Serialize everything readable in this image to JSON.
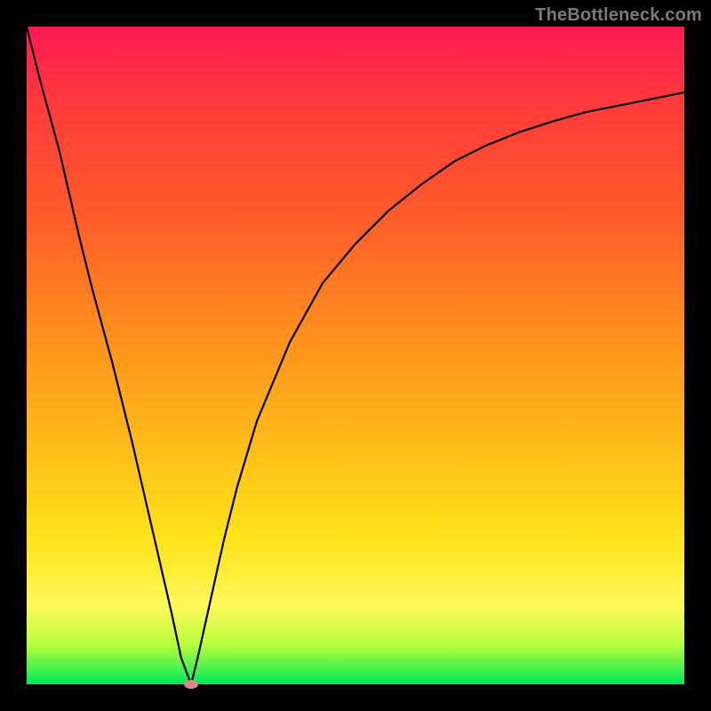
{
  "watermark": "TheBottleneck.com",
  "colors": {
    "frame_background": "#000000",
    "gradient_top": "#ff1a53",
    "gradient_bottom": "#00e85a",
    "curve_stroke": "#000000",
    "marker_fill": "#d98a8a"
  },
  "chart_data": {
    "type": "line",
    "title": "",
    "xlabel": "",
    "ylabel": "",
    "xlim": [
      0,
      100
    ],
    "ylim": [
      0,
      100
    ],
    "grid": false,
    "legend": false,
    "annotations": [
      {
        "text": "TheBottleneck.com",
        "position": "top-right"
      }
    ],
    "series": [
      {
        "name": "bottleneck-curve",
        "x": [
          0,
          2,
          5,
          8,
          10,
          13,
          16,
          19,
          22,
          23.5,
          25,
          26,
          28,
          30,
          32,
          35,
          40,
          45,
          50,
          55,
          60,
          65,
          70,
          75,
          80,
          85,
          90,
          95,
          100
        ],
        "y": [
          100,
          92,
          81,
          68,
          60,
          49,
          37,
          24,
          11,
          4,
          0,
          4,
          13,
          22,
          30,
          40,
          52,
          61,
          67,
          72,
          76,
          79.5,
          82,
          84,
          85.6,
          87,
          88,
          89,
          90
        ]
      }
    ],
    "markers": [
      {
        "name": "min-point",
        "x": 25,
        "y": 0
      }
    ]
  }
}
